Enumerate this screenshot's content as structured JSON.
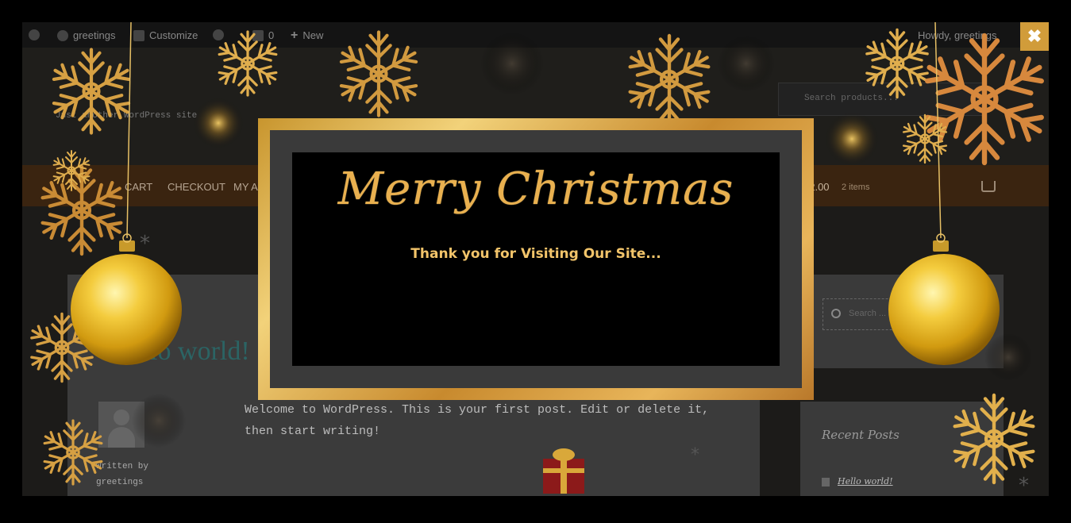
{
  "admin_bar": {
    "site_name": "greetings",
    "customize": "Customize",
    "comments": "0",
    "new": "New",
    "howdy": "Howdy, greetings"
  },
  "site": {
    "tagline": "Just another WordPress site",
    "search_placeholder": "Search products..."
  },
  "nav": {
    "items": [
      "CART",
      "CHECKOUT",
      "MY ACCOUNT"
    ],
    "cart_amount": "$2.00",
    "cart_count": "2 items"
  },
  "post": {
    "title": "Hello world!",
    "body": "Welcome to WordPress. This is your first post. Edit or delete it, then start writing!",
    "written_by_label": "Written by",
    "author": "greetings"
  },
  "sidebar": {
    "search_placeholder": "Search ...",
    "recent_posts_title": "Recent Posts",
    "recent_posts": [
      "Hello world!"
    ]
  },
  "modal": {
    "title": "Merry Christmas",
    "subtitle": "Thank you for Visiting Our Site..."
  },
  "close_label": "✖",
  "colors": {
    "gold": "#e9b04f",
    "gold_dark": "#c8952e",
    "modal_gray": "#3a3a3a",
    "close_bg": "#d19c3a"
  }
}
